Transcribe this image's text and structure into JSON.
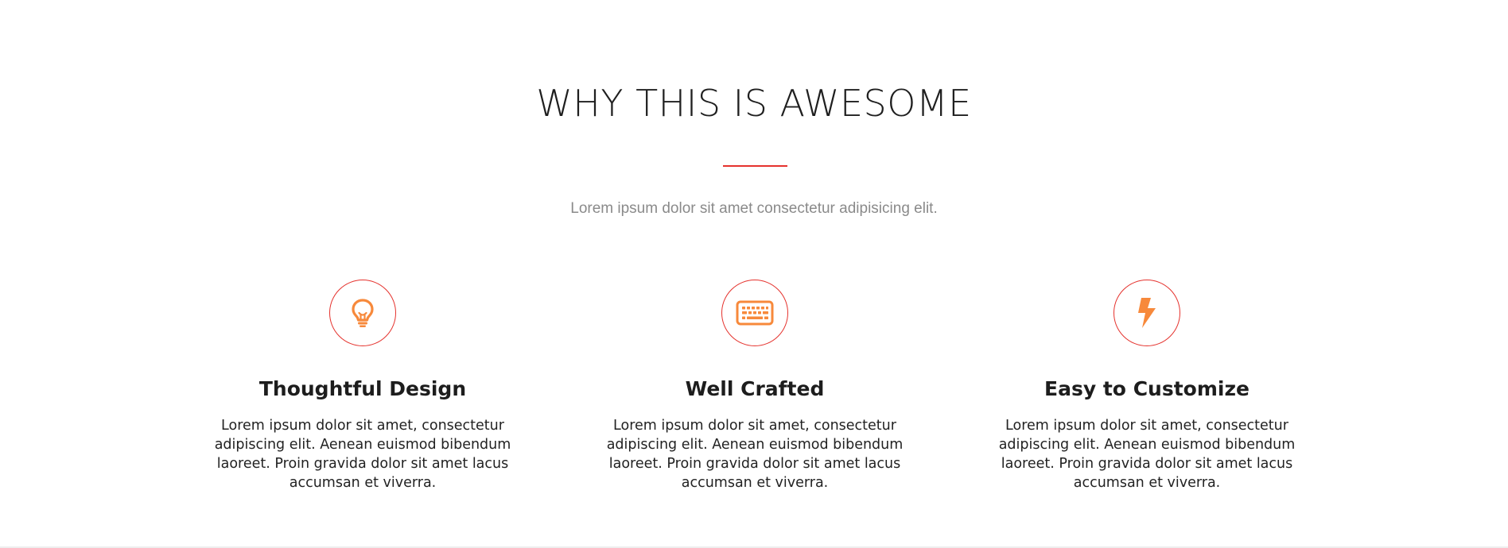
{
  "section": {
    "title": "WHY THIS IS AWESOME",
    "subtitle": "Lorem ipsum dolor sit amet consectetur adipisicing elit.",
    "accent_color": "#e5322d",
    "icon_color": "#f7893b"
  },
  "features": [
    {
      "icon": "lightbulb-icon",
      "title": "Thoughtful Design",
      "text": "Lorem ipsum dolor sit amet, consectetur adipiscing elit. Aenean euismod bibendum laoreet. Proin gravida dolor sit amet lacus accumsan et viverra."
    },
    {
      "icon": "keyboard-icon",
      "title": "Well Crafted",
      "text": "Lorem ipsum dolor sit amet, consectetur adipiscing elit. Aenean euismod bibendum laoreet. Proin gravida dolor sit amet lacus accumsan et viverra."
    },
    {
      "icon": "lightning-bolt-icon",
      "title": "Easy to Customize",
      "text": "Lorem ipsum dolor sit amet, consectetur adipiscing elit. Aenean euismod bibendum laoreet. Proin gravida dolor sit amet lacus accumsan et viverra."
    }
  ]
}
